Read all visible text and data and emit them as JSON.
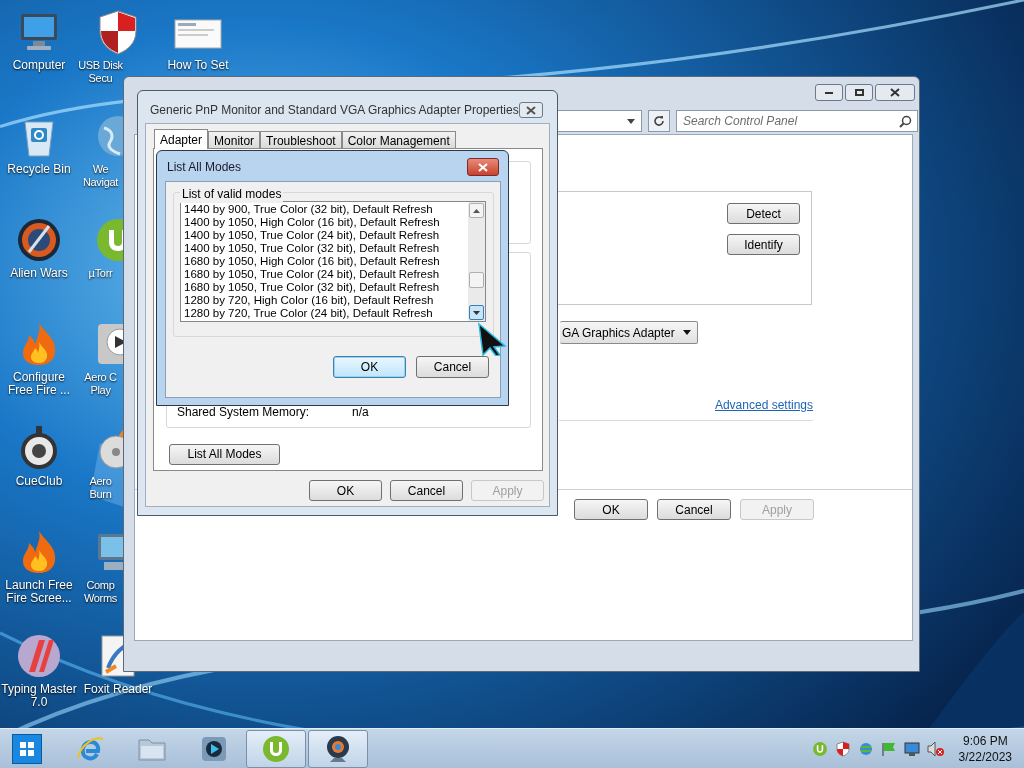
{
  "desktop_columns": [
    [
      {
        "kind": "computer",
        "lines": [
          "Computer"
        ],
        "cut": false
      },
      {
        "kind": "recycle",
        "lines": [
          "Recycle Bin"
        ],
        "cut": false
      },
      {
        "kind": "alien",
        "lines": [
          "Alien Wars"
        ],
        "cut": false
      },
      {
        "kind": "fire",
        "lines": [
          "Configure",
          "Free Fire ..."
        ],
        "cut": false
      },
      {
        "kind": "cue",
        "lines": [
          "CueClub"
        ],
        "cut": false
      },
      {
        "kind": "fire",
        "lines": [
          "Launch Free",
          "Fire Scree..."
        ],
        "cut": false
      },
      {
        "kind": "typing",
        "lines": [
          "Typing Master",
          "7.0"
        ],
        "cut": false
      }
    ],
    [
      {
        "kind": "shield",
        "lines": [
          "USB Disk",
          "Secu"
        ],
        "cut": true,
        "icon_cut": false
      },
      {
        "kind": "globe",
        "lines": [
          "We",
          "Navigat"
        ],
        "cut": true,
        "icon_cut": true
      },
      {
        "kind": "utorrent",
        "lines": [
          "µTorr"
        ],
        "cut": true,
        "icon_cut": true
      },
      {
        "kind": "media",
        "lines": [
          "Aero C",
          "Play"
        ],
        "cut": true,
        "icon_cut": true
      },
      {
        "kind": "disc",
        "lines": [
          "Aero",
          "Burn"
        ],
        "cut": true,
        "icon_cut": true
      },
      {
        "kind": "worms",
        "lines": [
          "Comp",
          "Worms"
        ],
        "cut": true,
        "icon_cut": true
      },
      {
        "kind": "foxit",
        "lines": [
          "Foxit Reader"
        ],
        "cut": false,
        "icon_cut": false
      }
    ],
    [
      {
        "kind": "document",
        "lines": [
          "How To Set"
        ],
        "cut": false
      }
    ]
  ],
  "control_panel": {
    "search": {
      "placeholder": "Search Control Panel"
    },
    "side_buttons": [
      {
        "label": "Detect",
        "disabled": false
      },
      {
        "label": "Identify",
        "disabled": false
      }
    ],
    "adapter_dropdown": "GA Graphics Adapter",
    "link": "Advanced settings",
    "buttons": [
      {
        "label": "OK",
        "disabled": false
      },
      {
        "label": "Cancel",
        "disabled": false
      },
      {
        "label": "Apply",
        "disabled": true
      }
    ]
  },
  "properties_dialog": {
    "title": "Generic PnP Monitor and Standard VGA Graphics Adapter Properties",
    "tabs": [
      {
        "label": "Adapter",
        "selected": true
      },
      {
        "label": "Monitor",
        "selected": false
      },
      {
        "label": "Troubleshoot",
        "selected": false
      },
      {
        "label": "Color Management",
        "selected": false
      }
    ],
    "rows": [
      {
        "label": "Shared System Memory:",
        "value": "n/a"
      }
    ],
    "list_button": "List All Modes",
    "buttons": [
      {
        "label": "OK",
        "disabled": false
      },
      {
        "label": "Cancel",
        "disabled": false
      },
      {
        "label": "Apply",
        "disabled": true
      }
    ]
  },
  "modes_dialog": {
    "title": "List All Modes",
    "group_label": "List of valid modes",
    "modes": [
      "1440 by 900, True Color (32 bit), Default Refresh",
      "1400 by 1050, High Color (16 bit), Default Refresh",
      "1400 by 1050, True Color (24 bit), Default Refresh",
      "1400 by 1050, True Color (32 bit), Default Refresh",
      "1680 by 1050, High Color (16 bit), Default Refresh",
      "1680 by 1050, True Color (24 bit), Default Refresh",
      "1680 by 1050, True Color (32 bit), Default Refresh",
      "1280 by 720, High Color (16 bit), Default Refresh",
      "1280 by 720, True Color (24 bit), Default Refresh"
    ],
    "buttons": [
      {
        "label": "OK",
        "focused": true
      },
      {
        "label": "Cancel",
        "focused": false
      }
    ]
  },
  "taskbar": {
    "apps": [
      {
        "kind": "ie",
        "active": false
      },
      {
        "kind": "folder",
        "active": false
      },
      {
        "kind": "media",
        "active": false
      },
      {
        "kind": "utorrent",
        "active": true
      },
      {
        "kind": "webcam",
        "active": true
      }
    ],
    "tray": [
      {
        "kind": "utorrent"
      },
      {
        "kind": "shield"
      },
      {
        "kind": "network"
      },
      {
        "kind": "flag"
      },
      {
        "kind": "monitor"
      },
      {
        "kind": "mute"
      }
    ],
    "time": "9:06 PM",
    "date": "3/22/2023"
  }
}
